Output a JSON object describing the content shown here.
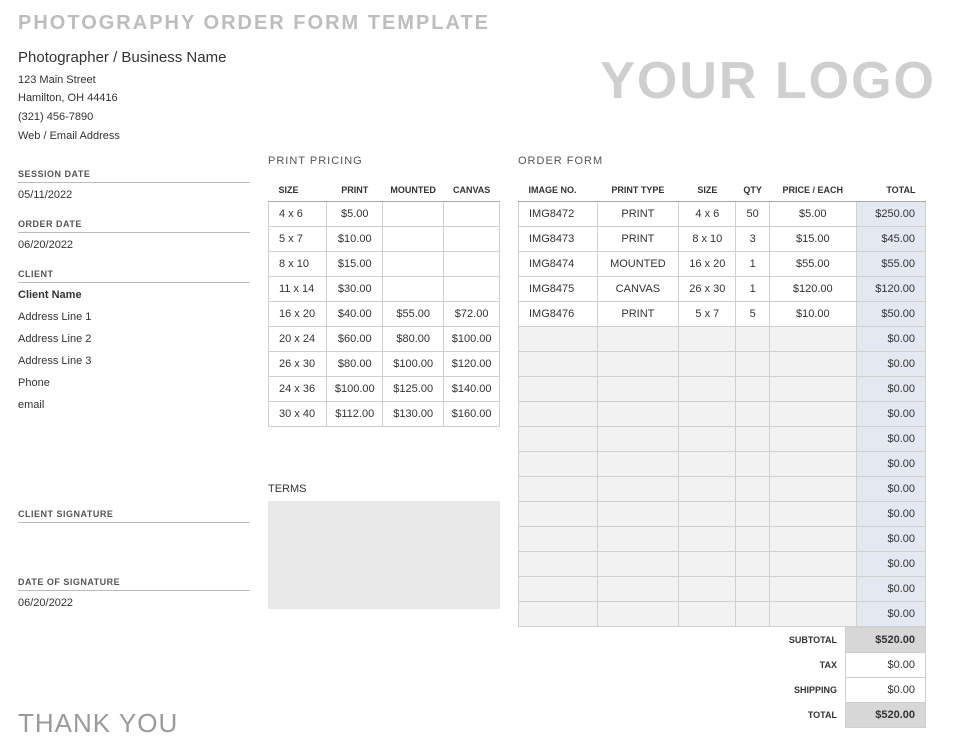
{
  "title": "PHOTOGRAPHY ORDER FORM TEMPLATE",
  "logo_text": "YOUR LOGO",
  "business": {
    "name": "Photographer / Business Name",
    "addr1": "123 Main Street",
    "addr2": "Hamilton, OH 44416",
    "phone": "(321) 456-7890",
    "web": "Web / Email Address"
  },
  "sidebar": {
    "session_date_label": "SESSION DATE",
    "session_date": "05/11/2022",
    "order_date_label": "ORDER DATE",
    "order_date": "06/20/2022",
    "client_label": "CLIENT",
    "client_name": "Client Name",
    "addr1": "Address Line 1",
    "addr2": "Address Line 2",
    "addr3": "Address Line 3",
    "client_phone": "Phone",
    "client_email": "email",
    "client_signature_label": "CLIENT SIGNATURE",
    "date_signature_label": "DATE OF SIGNATURE",
    "date_signature": "06/20/2022"
  },
  "pricing": {
    "heading": "PRINT PRICING",
    "cols": {
      "size": "SIZE",
      "print": "PRINT",
      "mounted": "MOUNTED",
      "canvas": "CANVAS"
    },
    "rows": [
      {
        "size": "4 x 6",
        "print": "$5.00",
        "mounted": "",
        "canvas": ""
      },
      {
        "size": "5 x 7",
        "print": "$10.00",
        "mounted": "",
        "canvas": ""
      },
      {
        "size": "8 x 10",
        "print": "$15.00",
        "mounted": "",
        "canvas": ""
      },
      {
        "size": "11 x 14",
        "print": "$30.00",
        "mounted": "",
        "canvas": ""
      },
      {
        "size": "16 x 20",
        "print": "$40.00",
        "mounted": "$55.00",
        "canvas": "$72.00"
      },
      {
        "size": "20 x 24",
        "print": "$60.00",
        "mounted": "$80.00",
        "canvas": "$100.00"
      },
      {
        "size": "26 x 30",
        "print": "$80.00",
        "mounted": "$100.00",
        "canvas": "$120.00"
      },
      {
        "size": "24 x 36",
        "print": "$100.00",
        "mounted": "$125.00",
        "canvas": "$140.00"
      },
      {
        "size": "30 x 40",
        "print": "$112.00",
        "mounted": "$130.00",
        "canvas": "$160.00"
      }
    ],
    "terms_label": "TERMS"
  },
  "order": {
    "heading": "ORDER FORM",
    "cols": {
      "img": "IMAGE NO.",
      "type": "PRINT TYPE",
      "size": "SIZE",
      "qty": "QTY",
      "price": "PRICE / EACH",
      "total": "TOTAL"
    },
    "rows": [
      {
        "img": "IMG8472",
        "type": "PRINT",
        "size": "4 x 6",
        "qty": "50",
        "price": "$5.00",
        "total": "$250.00"
      },
      {
        "img": "IMG8473",
        "type": "PRINT",
        "size": "8 x 10",
        "qty": "3",
        "price": "$15.00",
        "total": "$45.00"
      },
      {
        "img": "IMG8474",
        "type": "MOUNTED",
        "size": "16 x 20",
        "qty": "1",
        "price": "$55.00",
        "total": "$55.00"
      },
      {
        "img": "IMG8475",
        "type": "CANVAS",
        "size": "26 x 30",
        "qty": "1",
        "price": "$120.00",
        "total": "$120.00"
      },
      {
        "img": "IMG8476",
        "type": "PRINT",
        "size": "5 x 7",
        "qty": "5",
        "price": "$10.00",
        "total": "$50.00"
      },
      {
        "img": "",
        "type": "",
        "size": "",
        "qty": "",
        "price": "",
        "total": "$0.00"
      },
      {
        "img": "",
        "type": "",
        "size": "",
        "qty": "",
        "price": "",
        "total": "$0.00"
      },
      {
        "img": "",
        "type": "",
        "size": "",
        "qty": "",
        "price": "",
        "total": "$0.00"
      },
      {
        "img": "",
        "type": "",
        "size": "",
        "qty": "",
        "price": "",
        "total": "$0.00"
      },
      {
        "img": "",
        "type": "",
        "size": "",
        "qty": "",
        "price": "",
        "total": "$0.00"
      },
      {
        "img": "",
        "type": "",
        "size": "",
        "qty": "",
        "price": "",
        "total": "$0.00"
      },
      {
        "img": "",
        "type": "",
        "size": "",
        "qty": "",
        "price": "",
        "total": "$0.00"
      },
      {
        "img": "",
        "type": "",
        "size": "",
        "qty": "",
        "price": "",
        "total": "$0.00"
      },
      {
        "img": "",
        "type": "",
        "size": "",
        "qty": "",
        "price": "",
        "total": "$0.00"
      },
      {
        "img": "",
        "type": "",
        "size": "",
        "qty": "",
        "price": "",
        "total": "$0.00"
      },
      {
        "img": "",
        "type": "",
        "size": "",
        "qty": "",
        "price": "",
        "total": "$0.00"
      },
      {
        "img": "",
        "type": "",
        "size": "",
        "qty": "",
        "price": "",
        "total": "$0.00"
      }
    ],
    "summary": {
      "subtotal_label": "SUBTOTAL",
      "subtotal": "$520.00",
      "tax_label": "TAX",
      "tax": "$0.00",
      "shipping_label": "SHIPPING",
      "shipping": "$0.00",
      "total_label": "TOTAL",
      "total": "$520.00"
    }
  },
  "thanks": "THANK YOU"
}
